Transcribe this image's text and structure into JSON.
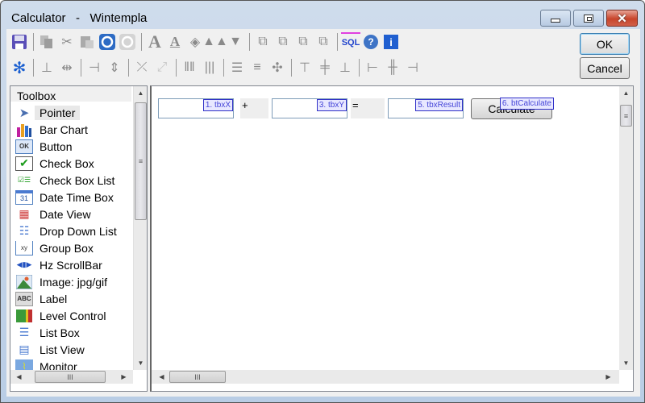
{
  "window": {
    "title": "Calculator   -   Wintempla",
    "controls": {
      "minimize": "minimize",
      "maximize": "maximize",
      "close": "✕"
    }
  },
  "toolbar": {
    "row1": [
      "save-icon",
      "copy-icon",
      "cut-icon",
      "paste-icon",
      "undo-icon",
      "redo-icon",
      "font-icon",
      "font-underline-icon",
      "fill-color-icon",
      "pencils-icon",
      "shirt-icon",
      "bring-front-icon",
      "send-back-icon",
      "bring-forward-icon",
      "send-backward-icon",
      "sql-icon",
      "help-icon",
      "info-icon"
    ],
    "row2": [
      "tab-order-icon",
      "center-horizontal-icon",
      "center-horizontal-fill-icon",
      "center-vertical-icon",
      "center-vertical-fill-icon",
      "shrink-icon",
      "expand-icon",
      "space-columns-icon",
      "space-columns-equal-icon",
      "space-rows-icon",
      "space-rows-equal-icon",
      "space-both-icon",
      "align-top-icon",
      "align-middle-icon",
      "align-bottom-icon",
      "align-left-icon",
      "align-center-icon",
      "align-right-icon"
    ],
    "ok_label": "OK",
    "cancel_label": "Cancel"
  },
  "toolbox": {
    "header": "Toolbox",
    "items": [
      {
        "label": "Pointer",
        "icon": "pointer-icon",
        "selected": true
      },
      {
        "label": "Bar Chart",
        "icon": "bar-chart-icon"
      },
      {
        "label": "Button",
        "icon": "button-icon"
      },
      {
        "label": "Check Box",
        "icon": "check-box-icon"
      },
      {
        "label": "Check Box List",
        "icon": "check-box-list-icon"
      },
      {
        "label": "Date Time Box",
        "icon": "calendar-icon"
      },
      {
        "label": "Date View",
        "icon": "date-view-icon"
      },
      {
        "label": "Drop Down List",
        "icon": "drop-down-list-icon"
      },
      {
        "label": "Group Box",
        "icon": "group-box-icon"
      },
      {
        "label": "Hz ScrollBar",
        "icon": "hz-scrollbar-icon"
      },
      {
        "label": "Image: jpg/gif",
        "icon": "image-icon"
      },
      {
        "label": "Label",
        "icon": "label-icon"
      },
      {
        "label": "Level Control",
        "icon": "level-control-icon"
      },
      {
        "label": "List Box",
        "icon": "list-box-icon"
      },
      {
        "label": "List View",
        "icon": "list-view-icon"
      },
      {
        "label": "Monitor",
        "icon": "monitor-icon"
      }
    ]
  },
  "canvas": {
    "controls": {
      "tbxX": {
        "tag": "1. tbxX",
        "value": ""
      },
      "plus": {
        "text": "+"
      },
      "tbxY": {
        "tag": "3. tbxY",
        "value": ""
      },
      "equals": {
        "text": "="
      },
      "tbxResult": {
        "tag": "5. tbxResult",
        "value": ""
      },
      "btCalculate": {
        "tag": "6. btCalculate",
        "label": "Calculate"
      }
    }
  },
  "scrollbars": {
    "thumb_grip": "III",
    "v_grip": "≡"
  }
}
